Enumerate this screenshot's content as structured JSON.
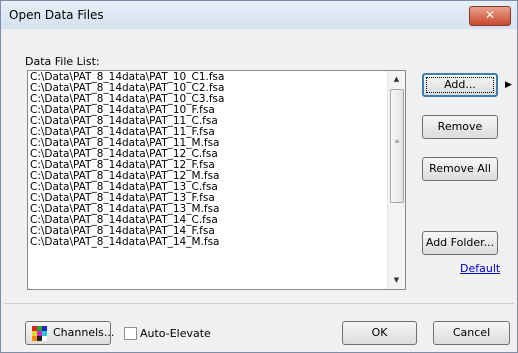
{
  "window": {
    "title": "Open Data Files",
    "close_glyph": "✕"
  },
  "list": {
    "label": "Data File List:",
    "items": [
      "C:\\Data\\PAT_8_14data\\PAT_10_C1.fsa",
      "C:\\Data\\PAT_8_14data\\PAT_10_C2.fsa",
      "C:\\Data\\PAT_8_14data\\PAT_10_C3.fsa",
      "C:\\Data\\PAT_8_14data\\PAT_10_F.fsa",
      "C:\\Data\\PAT_8_14data\\PAT_11_C.fsa",
      "C:\\Data\\PAT_8_14data\\PAT_11_F.fsa",
      "C:\\Data\\PAT_8_14data\\PAT_11_M.fsa",
      "C:\\Data\\PAT_8_14data\\PAT_12_C.fsa",
      "C:\\Data\\PAT_8_14data\\PAT_12_F.fsa",
      "C:\\Data\\PAT_8_14data\\PAT_12_M.fsa",
      "C:\\Data\\PAT_8_14data\\PAT_13_C.fsa",
      "C:\\Data\\PAT_8_14data\\PAT_13_F.fsa",
      "C:\\Data\\PAT_8_14data\\PAT_13_M.fsa",
      "C:\\Data\\PAT_8_14data\\PAT_14_C.fsa",
      "C:\\Data\\PAT_8_14data\\PAT_14_F.fsa",
      "C:\\Data\\PAT_8_14data\\PAT_14_M.fsa"
    ]
  },
  "buttons": {
    "add": "Add...",
    "remove": "Remove",
    "remove_all": "Remove All",
    "add_folder": "Add Folder...",
    "default_link": "Default",
    "channels": "Channels...",
    "ok": "OK",
    "cancel": "Cancel"
  },
  "auto_elevate": {
    "label": "Auto-Elevate",
    "checked": false
  },
  "icons": {
    "scroll_up": "▲",
    "scroll_down": "▼",
    "more": "▶",
    "channels_colors": [
      "#d22",
      "#2a2",
      "#22c",
      "#dd2",
      "#c2c",
      "#2cc",
      "#f80",
      "#222",
      "#ffffff"
    ]
  }
}
